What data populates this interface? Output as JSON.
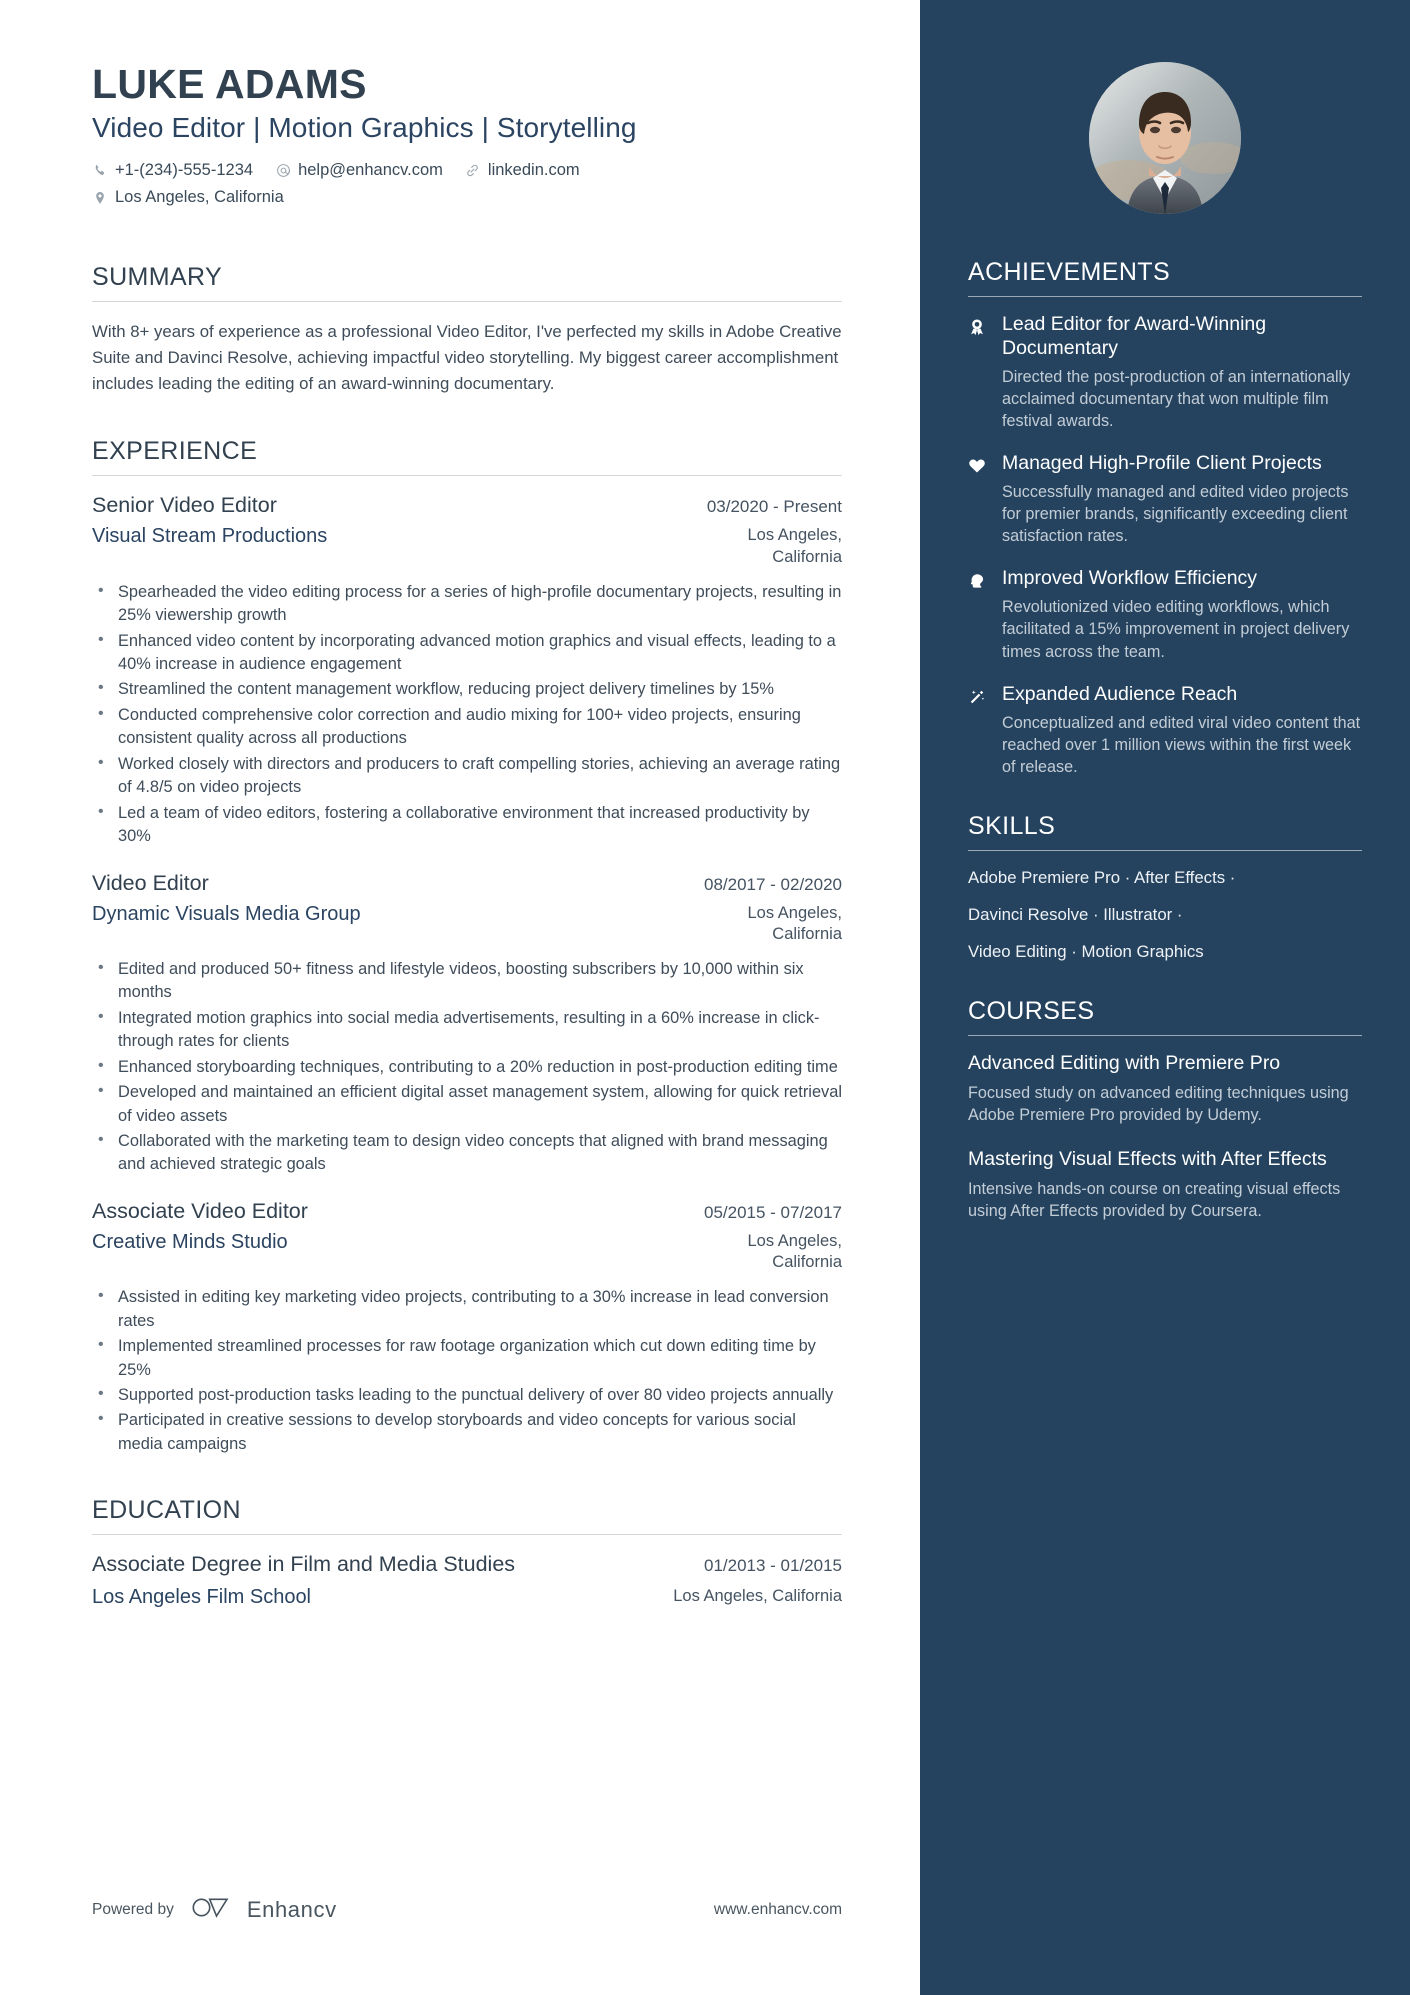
{
  "header": {
    "name": "LUKE ADAMS",
    "headline_parts": [
      "Video Editor",
      "Motion Graphics",
      "Storytelling"
    ],
    "headline": "Video Editor | Motion Graphics | Storytelling",
    "contacts": [
      {
        "icon": "phone-icon",
        "text": "+1-(234)-555-1234"
      },
      {
        "icon": "email-icon",
        "text": "help@enhancv.com"
      },
      {
        "icon": "link-icon",
        "text": "linkedin.com"
      }
    ],
    "location": {
      "icon": "location-pin-icon",
      "text": "Los Angeles, California"
    }
  },
  "summary": {
    "title": "SUMMARY",
    "text": "With 8+ years of experience as a professional Video Editor, I've perfected my skills in Adobe Creative Suite and Davinci Resolve, achieving impactful video storytelling. My biggest career accomplishment includes leading the editing of an award-winning documentary."
  },
  "experience": {
    "title": "EXPERIENCE",
    "jobs": [
      {
        "title": "Senior Video Editor",
        "date": "03/2020 - Present",
        "company": "Visual Stream Productions",
        "location": "Los Angeles, California",
        "bullets": [
          "Spearheaded the video editing process for a series of high-profile documentary projects, resulting in 25% viewership growth",
          "Enhanced video content by incorporating advanced motion graphics and visual effects, leading to a 40% increase in audience engagement",
          "Streamlined the content management workflow, reducing project delivery timelines by 15%",
          "Conducted comprehensive color correction and audio mixing for 100+ video projects, ensuring consistent quality across all productions",
          "Worked closely with directors and producers to craft compelling stories, achieving an average rating of 4.8/5 on video projects",
          "Led a team of video editors, fostering a collaborative environment that increased productivity by 30%"
        ]
      },
      {
        "title": "Video Editor",
        "date": "08/2017 - 02/2020",
        "company": "Dynamic Visuals Media Group",
        "location": "Los Angeles, California",
        "bullets": [
          "Edited and produced 50+ fitness and lifestyle videos, boosting subscribers by 10,000 within six months",
          "Integrated motion graphics into social media advertisements, resulting in a 60% increase in click-through rates for clients",
          "Enhanced storyboarding techniques, contributing to a 20% reduction in post-production editing time",
          "Developed and maintained an efficient digital asset management system, allowing for quick retrieval of video assets",
          "Collaborated with the marketing team to design video concepts that aligned with brand messaging and achieved strategic goals"
        ]
      },
      {
        "title": "Associate Video Editor",
        "date": "05/2015 - 07/2017",
        "company": "Creative Minds Studio",
        "location": "Los Angeles, California",
        "bullets": [
          "Assisted in editing key marketing video projects, contributing to a 30% increase in lead conversion rates",
          "Implemented streamlined processes for raw footage organization which cut down editing time by 25%",
          "Supported post-production tasks leading to the punctual delivery of over 80 video projects annually",
          "Participated in creative sessions to develop storyboards and video concepts for various social media campaigns"
        ]
      }
    ]
  },
  "education": {
    "title": "EDUCATION",
    "entries": [
      {
        "degree": "Associate Degree in Film and Media Studies",
        "date": "01/2013 - 01/2015",
        "school": "Los Angeles Film School",
        "location": "Los Angeles, California"
      }
    ]
  },
  "footer": {
    "powered_by": "Powered by",
    "brand": "Enhancv",
    "site": "www.enhancv.com"
  },
  "sidebar": {
    "achievements": {
      "title": "ACHIEVEMENTS",
      "items": [
        {
          "icon": "award-ribbon-icon",
          "title": "Lead Editor for Award-Winning Documentary",
          "desc": "Directed the post-production of an internationally acclaimed documentary that won multiple film festival awards."
        },
        {
          "icon": "heart-icon",
          "title": "Managed High-Profile Client Projects",
          "desc": "Successfully managed and edited video projects for premier brands, significantly exceeding client satisfaction rates."
        },
        {
          "icon": "head-profile-icon",
          "title": "Improved Workflow Efficiency",
          "desc": "Revolutionized video editing workflows, which facilitated a 15% improvement in project delivery times across the team."
        },
        {
          "icon": "magic-wand-icon",
          "title": "Expanded Audience Reach",
          "desc": "Conceptualized and edited viral video content that reached over 1 million views within the first week of release."
        }
      ]
    },
    "skills": {
      "title": "SKILLS",
      "lines": [
        "Adobe Premiere Pro · After Effects ·",
        "Davinci Resolve · Illustrator ·",
        "Video Editing · Motion Graphics"
      ],
      "items": [
        "Adobe Premiere Pro",
        "After Effects",
        "Davinci Resolve",
        "Illustrator",
        "Video Editing",
        "Motion Graphics"
      ]
    },
    "courses": {
      "title": "COURSES",
      "items": [
        {
          "title": "Advanced Editing with Premiere Pro",
          "desc": "Focused study on advanced editing techniques using Adobe Premiere Pro provided by Udemy."
        },
        {
          "title": "Mastering Visual Effects with After Effects",
          "desc": "Intensive hands-on course on creating visual effects using After Effects provided by Coursera."
        }
      ]
    }
  },
  "colors": {
    "sidebar_bg": "#25435f",
    "accent_blue": "#2b4462",
    "heading": "#32414f"
  }
}
